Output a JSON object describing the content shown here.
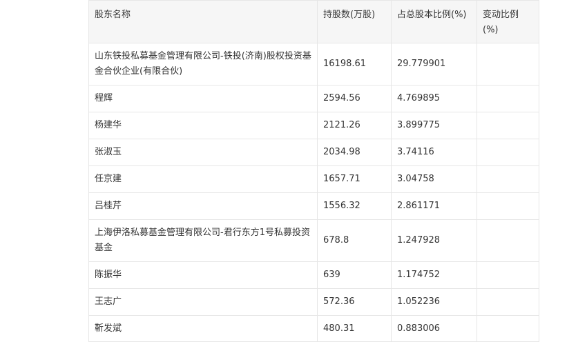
{
  "table": {
    "headers": [
      "股东名称",
      "持股数(万股)",
      "占总股本比例(%)",
      "变动比例(%)"
    ],
    "rows": [
      {
        "name": "山东铁投私募基金管理有限公司-铁投(济南)股权投资基金合伙企业(有限合伙)",
        "shares": "16198.61",
        "ratio": "29.779901",
        "change": ""
      },
      {
        "name": "程辉",
        "shares": "2594.56",
        "ratio": "4.769895",
        "change": ""
      },
      {
        "name": "杨建华",
        "shares": "2121.26",
        "ratio": "3.899775",
        "change": ""
      },
      {
        "name": "张淑玉",
        "shares": "2034.98",
        "ratio": "3.74116",
        "change": ""
      },
      {
        "name": "任京建",
        "shares": "1657.71",
        "ratio": "3.04758",
        "change": ""
      },
      {
        "name": "吕桂芹",
        "shares": "1556.32",
        "ratio": "2.861171",
        "change": ""
      },
      {
        "name": "上海伊洛私募基金管理有限公司-君行东方1号私募投资基金",
        "shares": "678.8",
        "ratio": "1.247928",
        "change": ""
      },
      {
        "name": "陈振华",
        "shares": "639",
        "ratio": "1.174752",
        "change": ""
      },
      {
        "name": "王志广",
        "shares": "572.36",
        "ratio": "1.052236",
        "change": ""
      },
      {
        "name": "靳发斌",
        "shares": "480.31",
        "ratio": "0.883006",
        "change": ""
      }
    ]
  }
}
